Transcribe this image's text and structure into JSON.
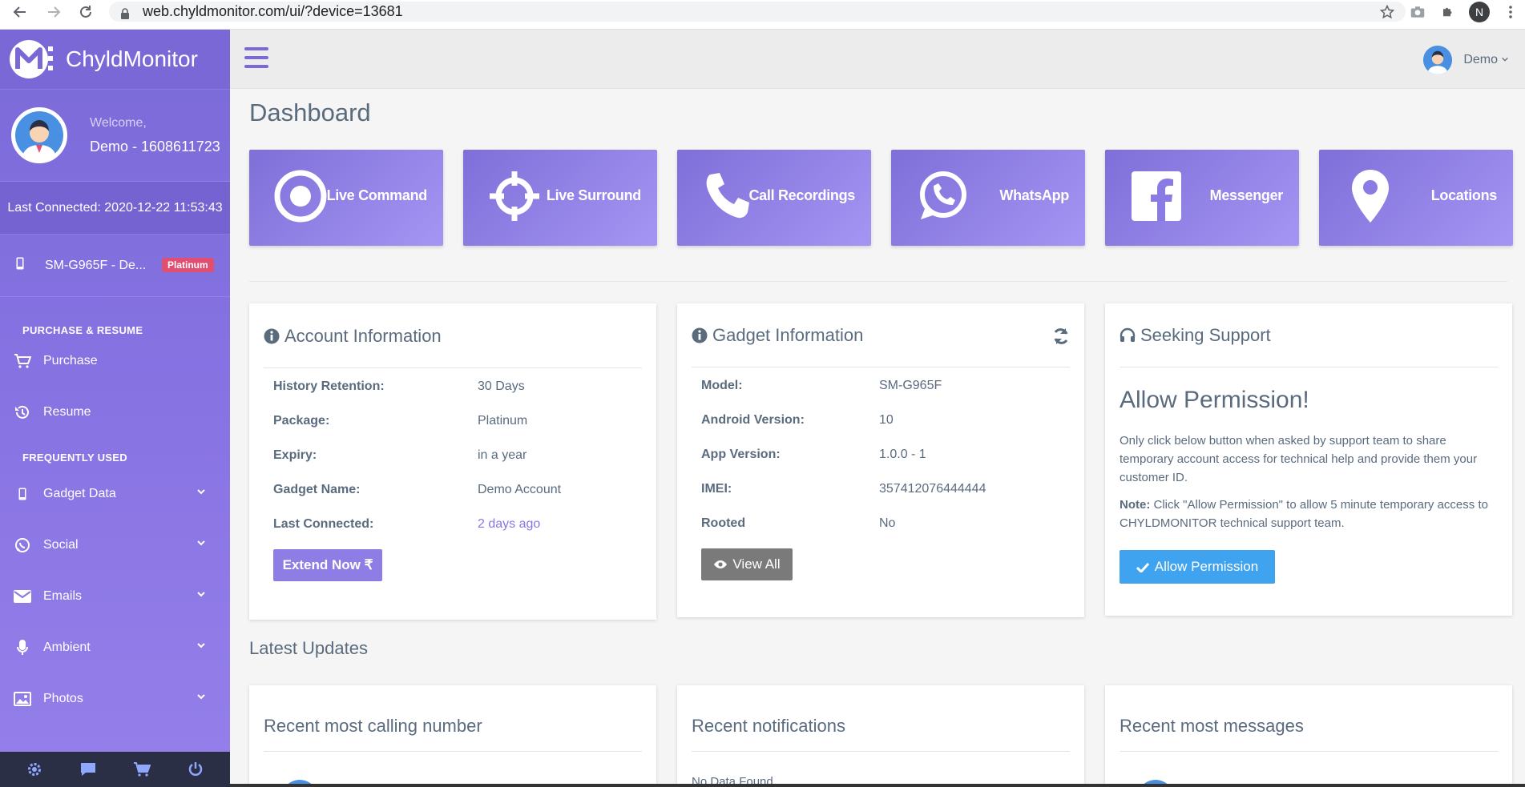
{
  "browser": {
    "url": "web.chyldmonitor.com/ui/?device=13681",
    "profile_initial": "N"
  },
  "brand": {
    "name": "ChyldMonitor"
  },
  "user": {
    "welcome": "Welcome,",
    "name": "Demo - 1608611723",
    "last_connected": "Last Connected: 2020-12-22 11:53:43"
  },
  "device": {
    "name": "SM-G965F - De...",
    "badge": "Platinum"
  },
  "sidebar": {
    "section_purchase": "PURCHASE & RESUME",
    "purchase": "Purchase",
    "resume": "Resume",
    "section_frequent": "FREQUENTLY USED",
    "items": [
      {
        "label": "Gadget Data",
        "icon": "phone-icon"
      },
      {
        "label": "Social",
        "icon": "whatsapp-icon"
      },
      {
        "label": "Emails",
        "icon": "envelope-icon"
      },
      {
        "label": "Ambient",
        "icon": "microphone-icon"
      },
      {
        "label": "Photos",
        "icon": "image-icon"
      }
    ]
  },
  "topbar": {
    "user_label": "Demo"
  },
  "page": {
    "title": "Dashboard"
  },
  "tiles": [
    {
      "label": "Live Command",
      "icon": "record-icon"
    },
    {
      "label": "Live Surround",
      "icon": "crosshair-icon"
    },
    {
      "label": "Call Recordings",
      "icon": "phone-icon"
    },
    {
      "label": "WhatsApp",
      "icon": "whatsapp-icon"
    },
    {
      "label": "Messenger",
      "icon": "facebook-icon"
    },
    {
      "label": "Locations",
      "icon": "map-pin-icon"
    }
  ],
  "account": {
    "title": "Account Information",
    "rows": [
      {
        "key": "History Retention:",
        "value": "30 Days"
      },
      {
        "key": "Package:",
        "value": "Platinum"
      },
      {
        "key": "Expiry:",
        "value": "in a year"
      },
      {
        "key": "Gadget Name:",
        "value": "Demo Account"
      },
      {
        "key": "Last Connected:",
        "value": "2 days ago"
      }
    ],
    "button": "Extend Now ₹"
  },
  "gadget": {
    "title": "Gadget Information",
    "rows": [
      {
        "key": "Model:",
        "value": "SM-G965F"
      },
      {
        "key": "Android Version:",
        "value": "10"
      },
      {
        "key": "App Version:",
        "value": "1.0.0 - 1"
      },
      {
        "key": "IMEI:",
        "value": "357412076444444"
      },
      {
        "key": "Rooted",
        "value": "No"
      }
    ],
    "button": "View All"
  },
  "support": {
    "title": "Seeking Support",
    "heading": "Allow Permission!",
    "text": "Only click below button when asked by support team to share temporary account access for technical help and provide them your customer ID.",
    "note_label": "Note:",
    "note_text": " Click \"Allow Permission\" to allow 5 minute temporary access to CHYLDMONITOR technical support team.",
    "button": "Allow Permission"
  },
  "latest": {
    "title": "Latest Updates",
    "cards": [
      {
        "title": "Recent most calling number"
      },
      {
        "title": "Recent notifications",
        "empty": "No Data Found."
      },
      {
        "title": "Recent most messages"
      }
    ]
  }
}
